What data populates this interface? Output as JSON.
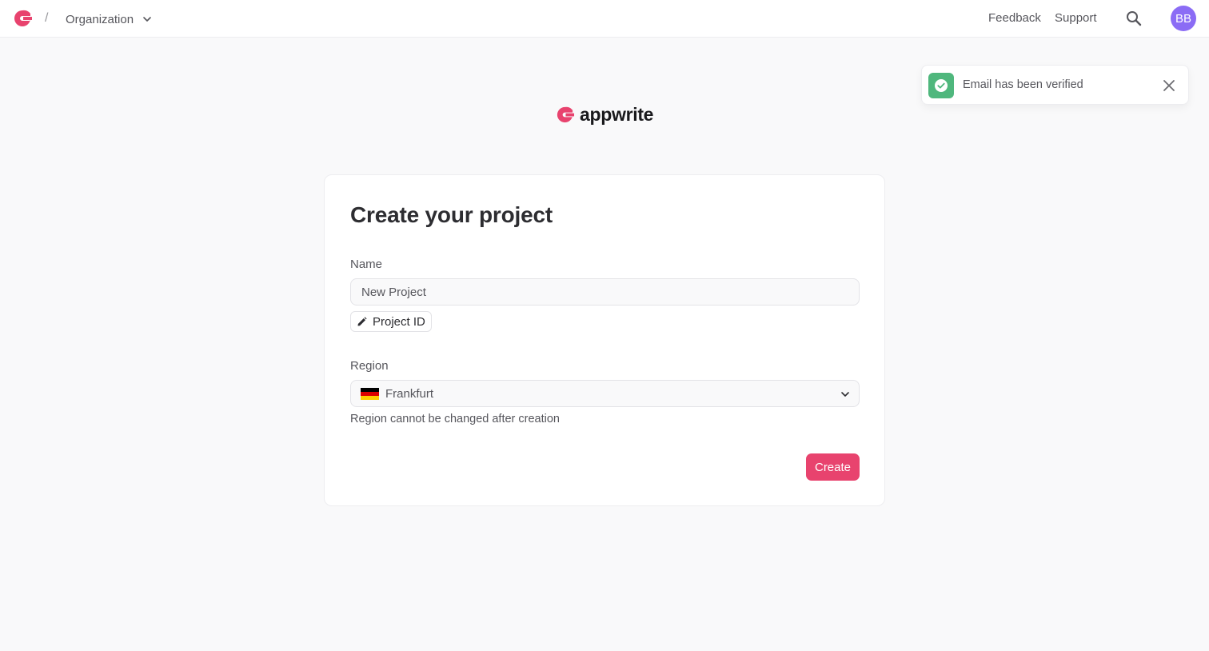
{
  "header": {
    "breadcrumb_separator": "/",
    "organization_label": "Organization",
    "links": {
      "feedback": "Feedback",
      "support": "Support"
    },
    "avatar_initials": "BB",
    "icons": {
      "logo": "appwrite-logo-icon",
      "chevron": "chevron-down-icon",
      "search": "search-icon"
    }
  },
  "toast": {
    "message": "Email has been verified",
    "icon": "check-circle-icon",
    "close_icon": "close-icon",
    "color": "#4fb77d"
  },
  "brand": {
    "wordmark": "appwrite"
  },
  "form": {
    "title": "Create your project",
    "name_label": "Name",
    "name_value": "New Project",
    "project_id_label": "Project ID",
    "region_label": "Region",
    "region_value": "Frankfurt",
    "region_flag": "germany-flag-icon",
    "region_helper": "Region cannot be changed after creation",
    "create_label": "Create"
  },
  "colors": {
    "accent": "#e8436e",
    "avatar": "#8b6cf5",
    "success": "#4fb77d"
  }
}
